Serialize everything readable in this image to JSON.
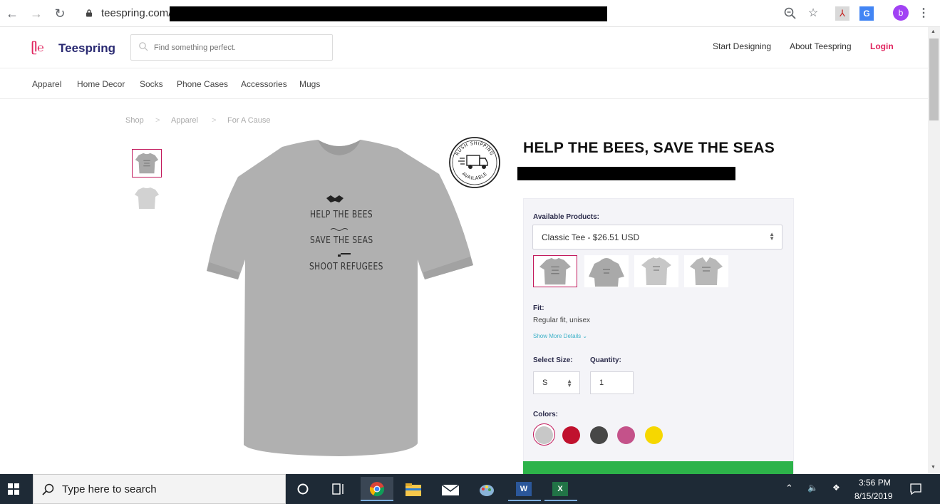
{
  "browser": {
    "url": "teespring.com/",
    "profile_initial": "b"
  },
  "site": {
    "logo": "Teespring",
    "search_placeholder": "Find something perfect.",
    "header_links": [
      "Start Designing",
      "About Teespring",
      "Login"
    ]
  },
  "categories": [
    "Apparel",
    "Home Decor",
    "Socks",
    "Phone Cases",
    "Accessories",
    "Mugs"
  ],
  "breadcrumb": [
    "Shop",
    "Apparel",
    "For A Cause"
  ],
  "shirt_print": [
    "HELP THE BEES",
    "SAVE THE SEAS",
    "SHOOT REFUGEES"
  ],
  "badge": {
    "top": "RUSH SHIPPING",
    "bottom": "AVAILABLE"
  },
  "product": {
    "title": "HELP THE BEES, SAVE THE SEAS",
    "available_label": "Available Products:",
    "selected_product": "Classic Tee - $26.51 USD",
    "fit_label": "Fit:",
    "fit_value": "Regular fit, unisex",
    "show_more": "Show More Details",
    "size_label": "Select Size:",
    "size_value": "S",
    "qty_label": "Quantity:",
    "qty_value": "1",
    "colors_label": "Colors:",
    "colors": [
      "#c8c8c8",
      "#c0112e",
      "#474747",
      "#c4528a",
      "#f6d700"
    ],
    "selected_color": "#c8c8c8"
  },
  "taskbar": {
    "search_placeholder": "Type here to search",
    "time": "3:56 PM",
    "date": "8/15/2019"
  }
}
